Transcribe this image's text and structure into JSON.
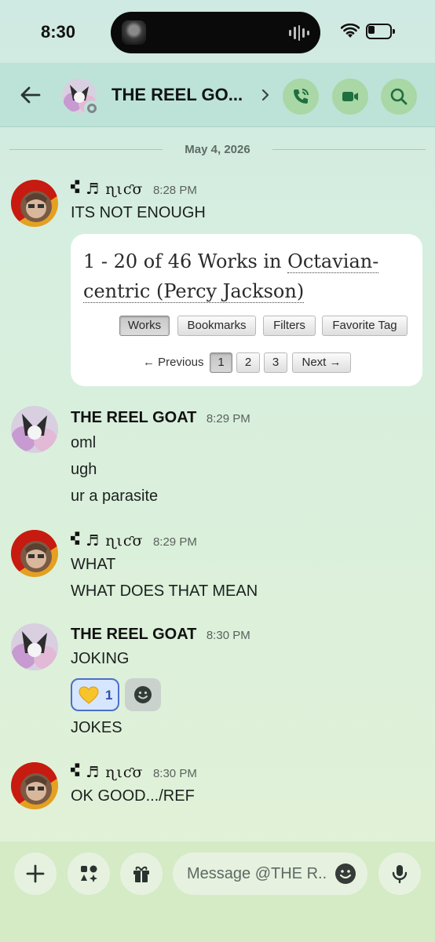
{
  "status_bar": {
    "time": "8:30"
  },
  "header": {
    "title": "THE REEL GO..."
  },
  "date_divider": "May 4, 2026",
  "messages": [
    {
      "author": "𜴞 ♬  ɳιƈσ",
      "time": "8:28 PM",
      "lines": [
        "ITS NOT ENOUGH"
      ]
    },
    {
      "author": "THE REEL GOAT",
      "time": "8:29 PM",
      "lines": [
        "oml",
        "ugh",
        "ur a parasite"
      ]
    },
    {
      "author": "𜴞 ♬  ɳιƈσ",
      "time": "8:29 PM",
      "lines": [
        "WHAT",
        "WHAT DOES THAT MEAN"
      ]
    },
    {
      "author": "THE REEL GOAT",
      "time": "8:30 PM",
      "lines": [
        "JOKING",
        "JOKES"
      ]
    },
    {
      "author": "𜴞 ♬  ɳιƈσ",
      "time": "8:30 PM",
      "lines": [
        "OK GOOD.../REF"
      ]
    }
  ],
  "embed": {
    "title_prefix": "1 - 20 of 46 Works in ",
    "title_link": "Octavian-centric (Percy Jackson)",
    "buttons": [
      "Works",
      "Bookmarks",
      "Filters",
      "Favorite Tag"
    ],
    "active_button": "Works",
    "pager": {
      "previous": "← Previous",
      "pages": [
        "1",
        "2",
        "3"
      ],
      "current": "1",
      "next": "Next →"
    }
  },
  "reaction": {
    "emoji": "yellow-heart-icon",
    "count": "1"
  },
  "composer": {
    "placeholder": "Message @THE R.."
  },
  "colors": {
    "accent_button": "#a9d7a5",
    "header_bg": "#bde3d8",
    "reaction_border": "#4d6fc7"
  }
}
